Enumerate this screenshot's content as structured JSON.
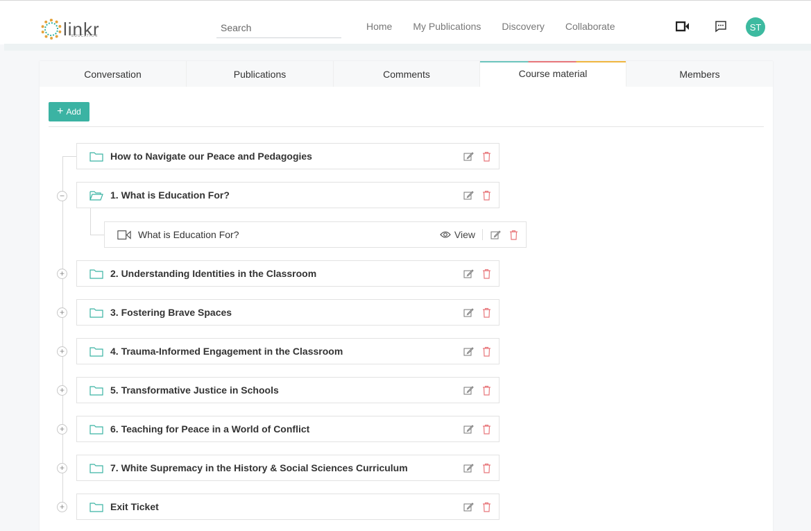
{
  "brand": {
    "name": "linkr",
    "sub": "EDUCATION"
  },
  "search": {
    "placeholder": "Search"
  },
  "nav": {
    "links": [
      "Home",
      "My Publications",
      "Discovery",
      "Collaborate"
    ]
  },
  "user": {
    "initials": "ST"
  },
  "colors": {
    "accent": "#3bb3a3",
    "delete": "#e8767a",
    "tab_gradient": [
      "#6cc5bd",
      "#e8767a",
      "#f0b63f"
    ]
  },
  "tabs": [
    "Conversation",
    "Publications",
    "Comments",
    "Course material",
    "Members"
  ],
  "active_tab": "Course material",
  "toolbar": {
    "add_label": "Add"
  },
  "tree": {
    "items": [
      {
        "title": "How to Navigate our Peace and Pedagogies",
        "toggle": "",
        "icon": "folder-icon"
      },
      {
        "title": "1. What is Education For?",
        "toggle": "−",
        "icon": "folder-open-icon",
        "children": [
          {
            "title": "What is Education For?",
            "icon": "video-icon",
            "view_label": "View"
          }
        ]
      },
      {
        "title": "2. Understanding Identities in the Classroom",
        "toggle": "+",
        "icon": "folder-icon"
      },
      {
        "title": "3. Fostering Brave Spaces",
        "toggle": "+",
        "icon": "folder-icon"
      },
      {
        "title": "4. Trauma-Informed Engagement in the Classroom",
        "toggle": "+",
        "icon": "folder-icon"
      },
      {
        "title": "5. Transformative Justice in Schools",
        "toggle": "+",
        "icon": "folder-icon"
      },
      {
        "title": "6. Teaching for Peace in a World of Conflict",
        "toggle": "+",
        "icon": "folder-icon"
      },
      {
        "title": "7. White Supremacy in the History & Social Sciences Curriculum",
        "toggle": "+",
        "icon": "folder-icon"
      },
      {
        "title": "Exit Ticket",
        "toggle": "+",
        "icon": "folder-icon"
      }
    ]
  }
}
